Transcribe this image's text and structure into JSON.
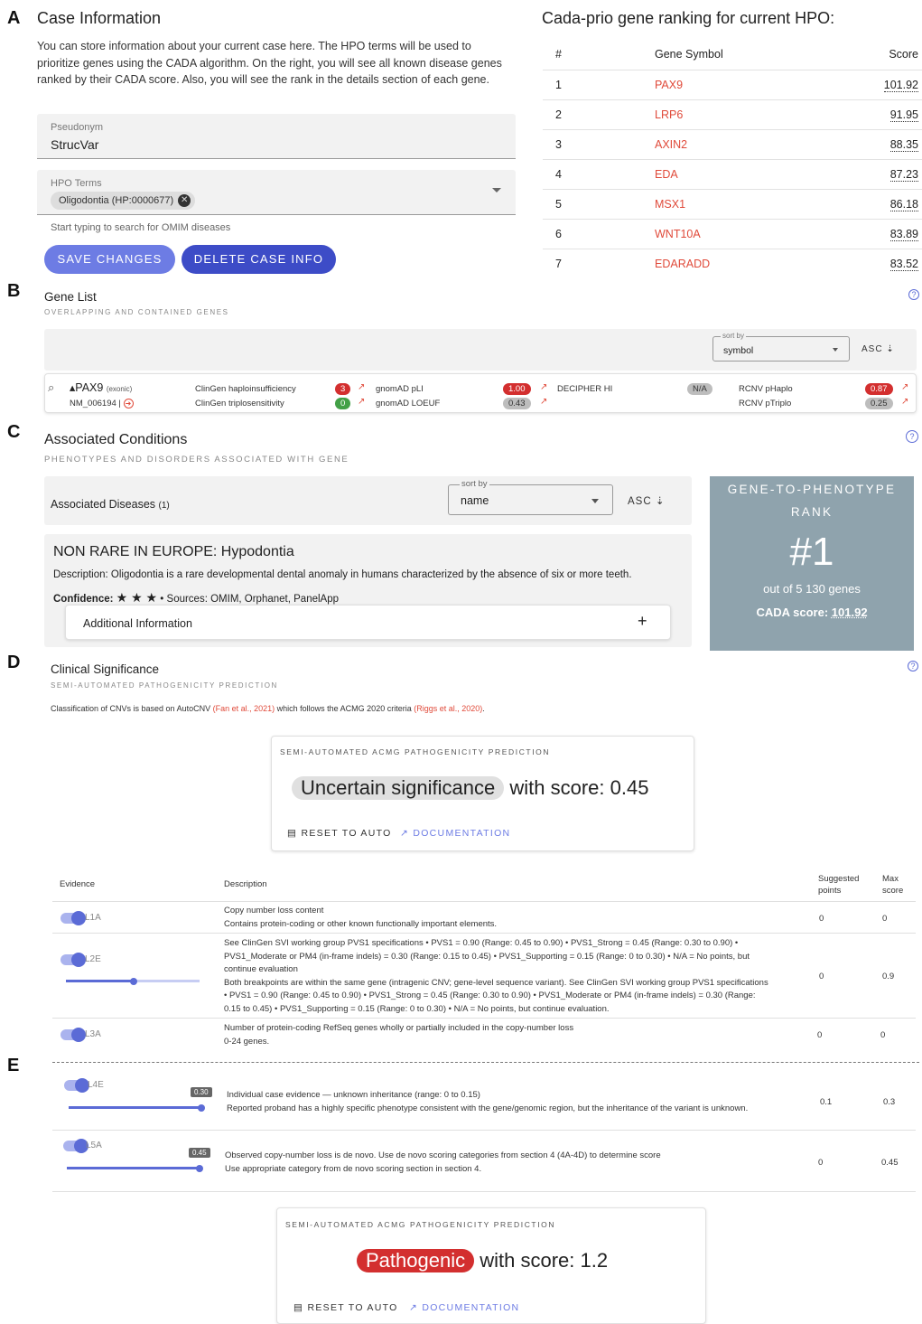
{
  "panels": {
    "a": "A",
    "b": "B",
    "c": "C",
    "d": "D",
    "e": "E"
  },
  "case": {
    "title": "Case Information",
    "description": "You can store information about your current case here. The HPO terms will be used to prioritize genes using the CADA algorithm. On the right, you will see all known disease genes ranked by their CADA score. Also, you will see the rank in the details section of each gene.",
    "pseudonym_label": "Pseudonym",
    "pseudonym_value": "StrucVar",
    "hpo_label": "HPO Terms",
    "hpo_chip": "Oligodontia (HP:0000677)",
    "hpo_hint": "Start typing to search for OMIM diseases",
    "save_label": "SAVE CHANGES",
    "delete_label": "DELETE CASE INFO"
  },
  "ranking": {
    "title": "Cada-prio gene ranking for current HPO:",
    "headers": [
      "#",
      "Gene Symbol",
      "Score"
    ],
    "rows": [
      {
        "rank": "1",
        "gene": "PAX9",
        "score": "101.92"
      },
      {
        "rank": "2",
        "gene": "LRP6",
        "score": "91.95"
      },
      {
        "rank": "3",
        "gene": "AXIN2",
        "score": "88.35"
      },
      {
        "rank": "4",
        "gene": "EDA",
        "score": "87.23"
      },
      {
        "rank": "5",
        "gene": "MSX1",
        "score": "86.18"
      },
      {
        "rank": "6",
        "gene": "WNT10A",
        "score": "83.89"
      },
      {
        "rank": "7",
        "gene": "EDARADD",
        "score": "83.52"
      }
    ]
  },
  "gene_list": {
    "title": "Gene List",
    "subtitle": "OVERLAPPING AND CONTAINED GENES",
    "sort_label": "sort by",
    "sort_value": "symbol",
    "order": "ASC",
    "gene": {
      "symbol": "PAX9",
      "tag": "(exonic)",
      "transcript": "NM_006194 |"
    },
    "metrics": {
      "clingen_hi_label": "ClinGen haploinsufficiency",
      "clingen_hi": "3",
      "clingen_ts_label": "ClinGen triplosensitivity",
      "clingen_ts": "0",
      "pli_label": "gnomAD pLI",
      "pli": "1.00",
      "loeuf_label": "gnomAD LOEUF",
      "loeuf": "0.43",
      "decipher_label": "DECIPHER HI",
      "decipher": "N/A",
      "phaplo_label": "RCNV pHaplo",
      "phaplo": "0.87",
      "ptriplo_label": "RCNV pTriplo",
      "ptriplo": "0.25"
    }
  },
  "conditions": {
    "title": "Associated Conditions",
    "subtitle": "PHENOTYPES AND DISORDERS ASSOCIATED WITH GENE",
    "list_label": "Associated Diseases",
    "list_count": "(1)",
    "sort_label": "sort by",
    "sort_value": "name",
    "order": "ASC",
    "disease_title": "NON RARE IN EUROPE: Hypodontia",
    "disease_description": "Description: Oligodontia is a rare developmental dental anomaly in humans characterized by the absence of six or more teeth.",
    "confidence_label": "Confidence:",
    "stars": "★ ★ ★",
    "sources": "• Sources: OMIM, Orphanet, PanelApp",
    "additional": "Additional Information",
    "rank_title_1": "GENE-TO-PHENOTYPE",
    "rank_title_2": "RANK",
    "rank_value": "#1",
    "rank_out_of": "out of 5 130 genes",
    "cada_label": "CADA score:",
    "cada_value": "101.92"
  },
  "clinical": {
    "title": "Clinical Significance",
    "subtitle": "SEMI-AUTOMATED PATHOGENICITY PREDICTION",
    "note_prefix": "Classification of CNVs is based on AutoCNV ",
    "note_ref1": "(Fan et al., 2021)",
    "note_mid": " which follows the ACMG 2020 criteria ",
    "note_ref2": "(Riggs et al., 2020)",
    "note_end": ".",
    "box_label": "SEMI-AUTOMATED ACMG PATHOGENICITY PREDICTION",
    "classification": "Uncertain significance",
    "score_text": "with score: 0.45",
    "reset_label": "RESET TO AUTO",
    "doc_label": "DOCUMENTATION"
  },
  "evidence": {
    "headers": {
      "evidence": "Evidence",
      "description": "Description",
      "suggested_1": "Suggested",
      "suggested_2": "points",
      "max_1": "Max",
      "max_2": "score"
    },
    "rows": [
      {
        "code": "L1A",
        "lines": [
          "Copy number loss content",
          "Contains protein-coding or other known functionally important elements."
        ],
        "points": "0",
        "max": "0"
      },
      {
        "code": "L2E",
        "lines": [
          "See ClinGen SVI working group PVS1 specifications • PVS1 = 0.90 (Range: 0.45 to 0.90) • PVS1_Strong = 0.45 (Range: 0.30 to 0.90) •",
          "PVS1_Moderate or PM4 (in-frame indels) = 0.30 (Range: 0.15 to 0.45) • PVS1_Supporting = 0.15 (Range: 0 to 0.30) • N/A = No points, but",
          "continue evaluation",
          "Both breakpoints are within the same gene (intragenic CNV; gene-level sequence variant). See ClinGen SVI working group PVS1 specifications",
          "• PVS1 = 0.90 (Range: 0.45 to 0.90) • PVS1_Strong = 0.45 (Range: 0.30 to 0.90) • PVS1_Moderate or PM4 (in-frame indels) = 0.30 (Range:",
          "0.15 to 0.45) • PVS1_Supporting = 0.15 (Range: 0 to 0.30) • N/A = No points, but continue evaluation."
        ],
        "points": "0",
        "max": "0.9"
      },
      {
        "code": "L3A",
        "lines": [
          "Number of protein-coding RefSeq genes wholly or partially included in the copy-number loss",
          "0-24 genes."
        ],
        "points": "0",
        "max": "0"
      }
    ],
    "rows_e": [
      {
        "code": "L4E",
        "slider_label": "0.30",
        "slider_fraction": 1.0,
        "lines": [
          "Individual case evidence — unknown inheritance (range: 0 to 0.15)",
          "Reported proband has a highly specific phenotype consistent with the gene/genomic region, but the inheritance of the variant is unknown."
        ],
        "points": "0.1",
        "max": "0.3"
      },
      {
        "code": "L5A",
        "slider_label": "0.45",
        "slider_fraction": 1.0,
        "lines": [
          "Observed copy-number loss is de novo. Use de novo scoring categories from section 4 (4A-4D) to determine score",
          "Use appropriate category from de novo scoring section in section 4."
        ],
        "points": "0",
        "max": "0.45"
      }
    ]
  },
  "final": {
    "box_label": "SEMI-AUTOMATED ACMG PATHOGENICITY PREDICTION",
    "classification": "Pathogenic",
    "score_text": "with score: 1.2",
    "reset_label": "RESET TO AUTO",
    "doc_label": "DOCUMENTATION"
  },
  "colors": {
    "accent": "#5b6bd6",
    "accent_dark": "#3d4cc7",
    "gene_red": "#e04a3a",
    "rank_panel": "#8fa3ad",
    "pathogenic": "#d32f2f"
  }
}
